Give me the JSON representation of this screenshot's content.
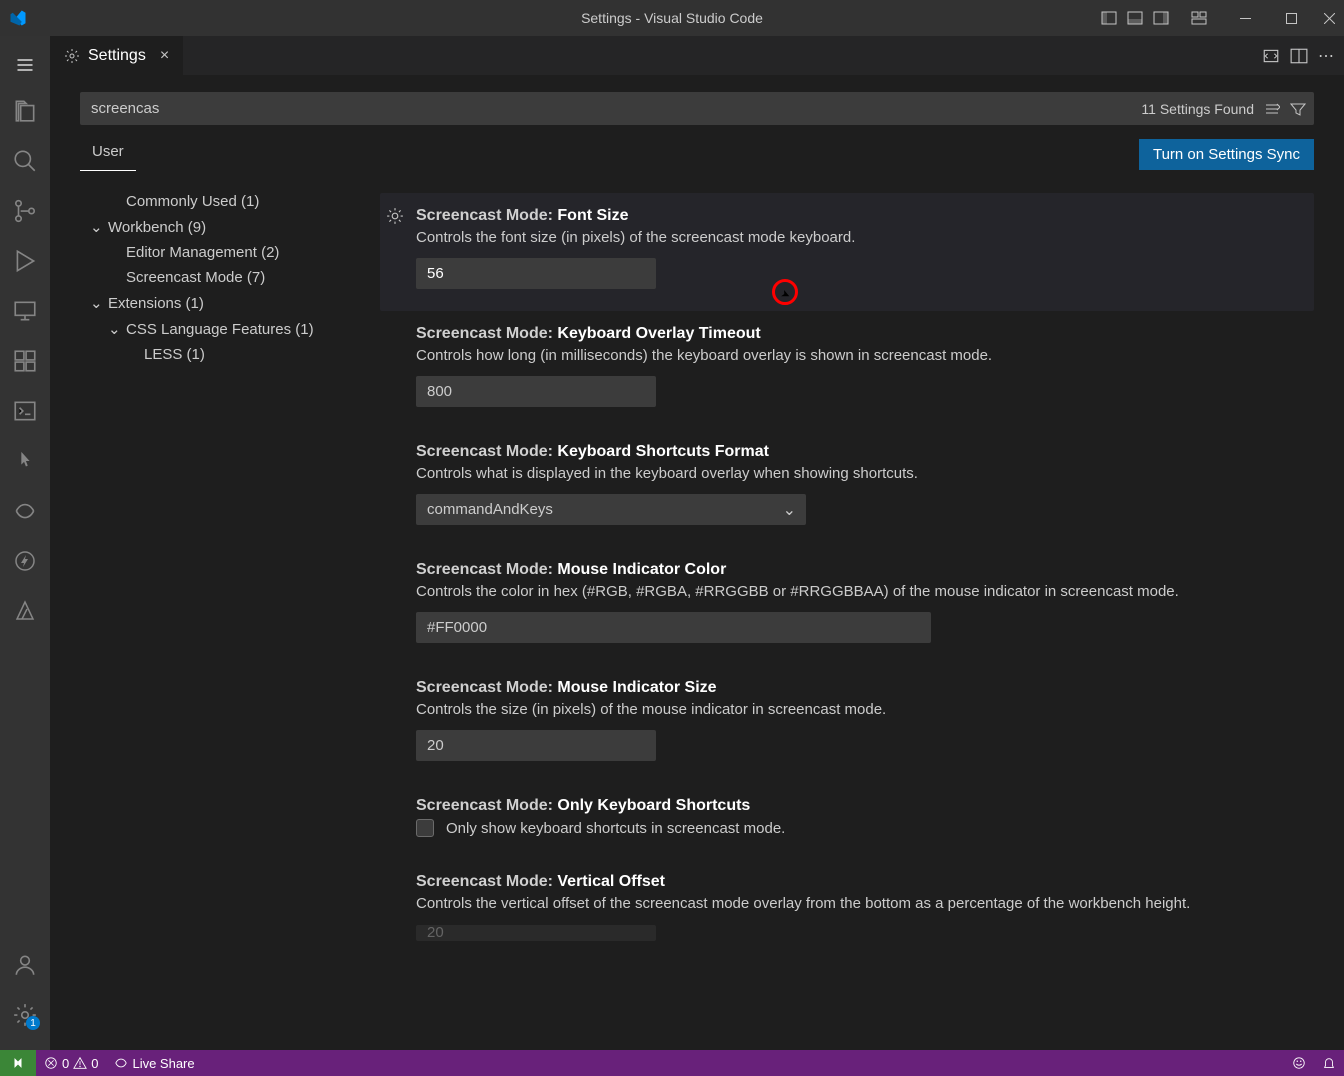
{
  "title": "Settings - Visual Studio Code",
  "tab": {
    "label": "Settings"
  },
  "search": {
    "value": "screencas",
    "results_label": "11 Settings Found"
  },
  "scope": {
    "user": "User"
  },
  "sync_button": "Turn on Settings Sync",
  "toc": {
    "commonly_used": "Commonly Used (1)",
    "workbench": "Workbench (9)",
    "editor_management": "Editor Management (2)",
    "screencast_mode": "Screencast Mode (7)",
    "extensions": "Extensions (1)",
    "css_language": "CSS Language Features (1)",
    "less": "LESS (1)"
  },
  "settings": [
    {
      "category": "Screencast Mode:",
      "name": "Font Size",
      "desc": "Controls the font size (in pixels) of the screencast mode keyboard.",
      "type": "number",
      "value": "56",
      "active": true
    },
    {
      "category": "Screencast Mode:",
      "name": "Keyboard Overlay Timeout",
      "desc": "Controls how long (in milliseconds) the keyboard overlay is shown in screencast mode.",
      "type": "number",
      "value": "800"
    },
    {
      "category": "Screencast Mode:",
      "name": "Keyboard Shortcuts Format",
      "desc": "Controls what is displayed in the keyboard overlay when showing shortcuts.",
      "type": "select",
      "value": "commandAndKeys"
    },
    {
      "category": "Screencast Mode:",
      "name": "Mouse Indicator Color",
      "desc": "Controls the color in hex (#RGB, #RGBA, #RRGGBB or #RRGGBBAA) of the mouse indicator in screencast mode.",
      "type": "text",
      "value": "#FF0000",
      "wide": true
    },
    {
      "category": "Screencast Mode:",
      "name": "Mouse Indicator Size",
      "desc": "Controls the size (in pixels) of the mouse indicator in screencast mode.",
      "type": "number",
      "value": "20"
    },
    {
      "category": "Screencast Mode:",
      "name": "Only Keyboard Shortcuts",
      "desc": "",
      "type": "checkbox",
      "checkbox_label": "Only show keyboard shortcuts in screencast mode.",
      "checked": false
    },
    {
      "category": "Screencast Mode:",
      "name": "Vertical Offset",
      "desc": "Controls the vertical offset of the screencast mode overlay from the bottom as a percentage of the workbench height.",
      "type": "number",
      "value": "20",
      "cutoff": true
    }
  ],
  "statusbar": {
    "errors": "0",
    "warnings": "0",
    "liveshare": "Live Share"
  },
  "gear_badge": "1"
}
